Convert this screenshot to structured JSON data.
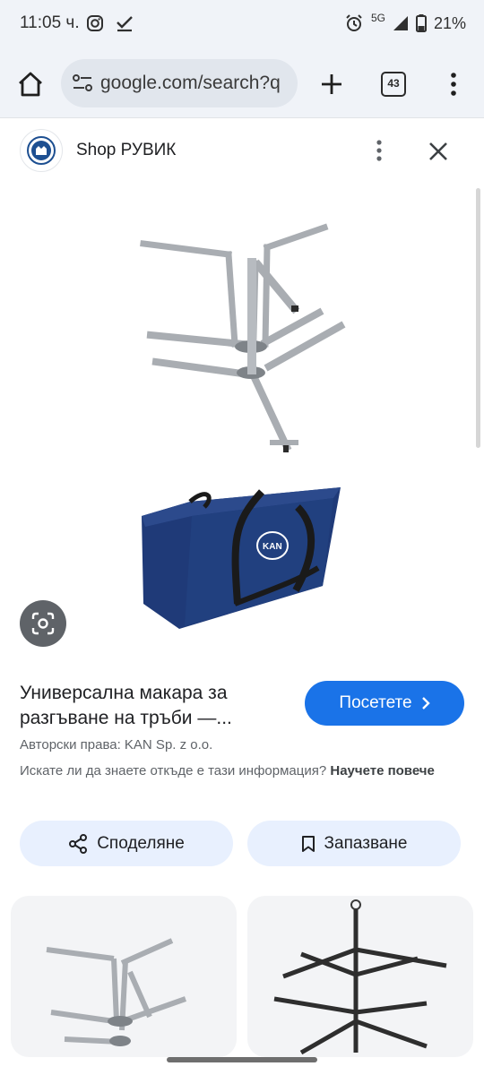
{
  "status_bar": {
    "time": "11:05 ч.",
    "network": "5G",
    "battery": "21%",
    "icons": [
      "instagram-icon",
      "check-icon",
      "alarm-icon",
      "signal-icon",
      "battery-icon"
    ]
  },
  "browser": {
    "url": "google.com/search?q",
    "tab_count": "43",
    "icons": [
      "home-icon",
      "tune-icon",
      "plus-icon",
      "tabs-icon",
      "more-vert-icon"
    ]
  },
  "panel": {
    "site_name": "Shop РУВИК",
    "icons": [
      "more-vert-icon",
      "close-icon",
      "lens-icon"
    ]
  },
  "product": {
    "title": "Универсална макара за разгъване на тръби —...",
    "visit_label": "Посетете",
    "copyright": "Авторски права: KAN Sp. z o.o.",
    "question": "Искате ли да знаете откъде е тази информация?",
    "learn_more": "Научете повече",
    "bag_logo": "KAN"
  },
  "actions": {
    "share_label": "Споделяне",
    "save_label": "Запазване"
  },
  "colors": {
    "accent": "#1a73e8",
    "action_bg": "#e8f0fe",
    "bar_bg": "#f0f3f8",
    "bag_blue": "#1f3a78"
  }
}
